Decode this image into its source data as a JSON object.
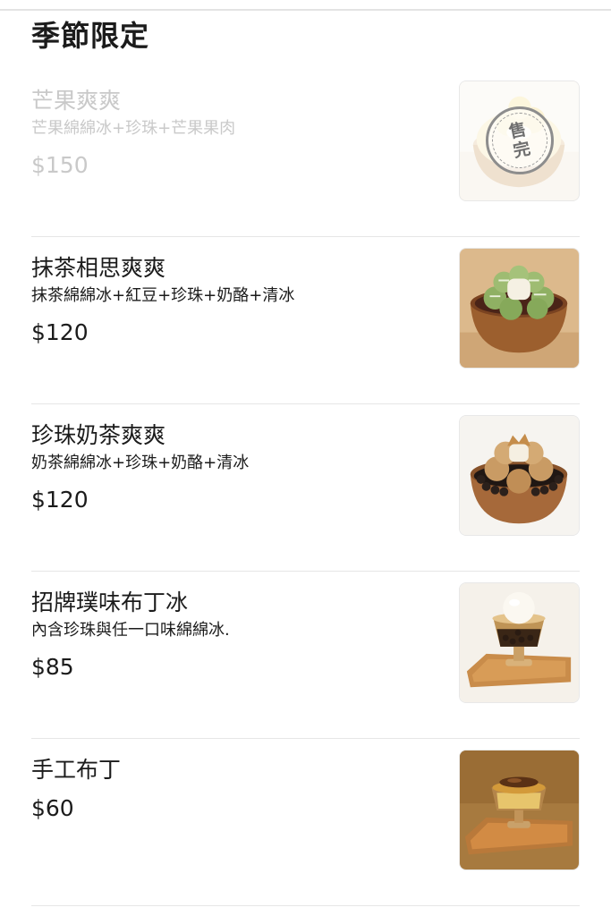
{
  "section": {
    "title": "季節限定"
  },
  "items": [
    {
      "name": "芒果爽爽",
      "desc": "芒果綿綿冰+珍珠+芒果果肉",
      "price": "$150",
      "sold_out": true,
      "badge": "售完",
      "image_icon": "mango-shaved-ice-icon"
    },
    {
      "name": "抹茶相思爽爽",
      "desc": "抹茶綿綿冰+紅豆+珍珠+奶酪+清冰",
      "price": "$120",
      "sold_out": false,
      "image_icon": "matcha-shaved-ice-icon"
    },
    {
      "name": "珍珠奶茶爽爽",
      "desc": "奶茶綿綿冰+珍珠+奶酪+清冰",
      "price": "$120",
      "sold_out": false,
      "image_icon": "milk-tea-shaved-ice-icon"
    },
    {
      "name": "招牌璞味布丁冰",
      "desc": "內含珍珠與任一口味綿綿冰.",
      "price": "$85",
      "sold_out": false,
      "image_icon": "pudding-ice-cup-icon"
    },
    {
      "name": "手工布丁",
      "desc": "",
      "price": "$60",
      "sold_out": false,
      "image_icon": "custard-pudding-icon"
    }
  ],
  "colors": {
    "text": "#1b1b1b",
    "sold_out_text": "#c9c9c9",
    "divider": "#e6e6e6",
    "wood": "#a86a35",
    "matcha": "#8fb063",
    "milk_tea": "#c99b64",
    "caramel": "#c98a2c"
  }
}
